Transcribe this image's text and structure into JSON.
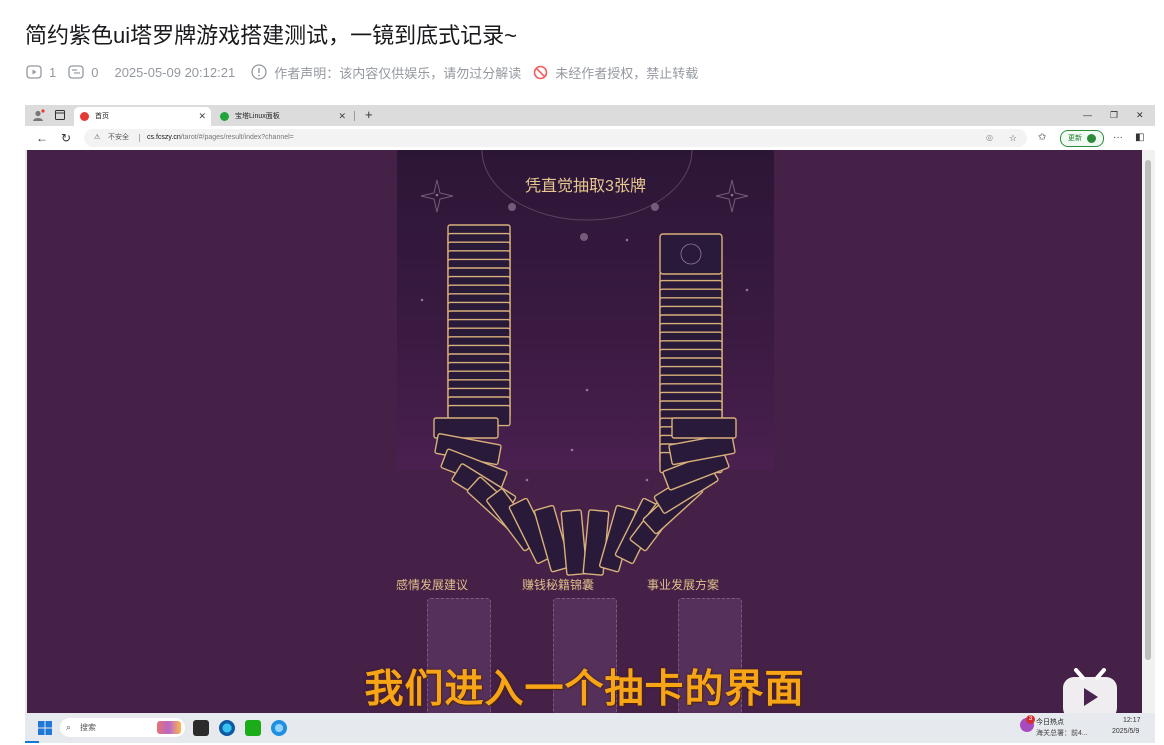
{
  "post": {
    "title": "简约紫色ui塔罗牌游戏搭建测试，一镜到底式记录~",
    "play_count": "1",
    "danmaku_count": "0",
    "datetime": "2025-05-09 20:12:21",
    "declaration": "作者声明：该内容仅供娱乐，请勿过分解读",
    "copyright": "未经作者授权，禁止转载"
  },
  "browser": {
    "tabs": [
      {
        "label": "首页",
        "active": true
      },
      {
        "label": "宝塔Linux面板",
        "active": false
      }
    ],
    "insecure_label": "不安全",
    "url_host": "cs.fcszy.cn",
    "url_path": "/tarot/#/pages/result/index?channel=",
    "update_label": "更新"
  },
  "tarot": {
    "heading": "凭直觉抽取3张牌",
    "slots": [
      {
        "label": "感情发展建议"
      },
      {
        "label": "赚钱秘籍锦囊"
      },
      {
        "label": "事业发展方案"
      }
    ]
  },
  "subtitle": "我们进入一个抽卡的界面",
  "taskbar": {
    "search_placeholder": "搜索",
    "news_badge": "3",
    "news_title": "今日热点",
    "news_sub": "海关总署：前4...",
    "time": "12:17",
    "date": "2025/5/9"
  },
  "colors": {
    "page_bg": "#452047",
    "card_border": "#d8b07a",
    "card_fill": "#2a1a3a",
    "subtitle": "#f7a516",
    "heading": "#e6c890"
  },
  "icons": [
    "play-count-icon",
    "danmaku-icon",
    "info-icon",
    "no-repost-icon",
    "bilibili-play-icon",
    "windows-start-icon"
  ]
}
